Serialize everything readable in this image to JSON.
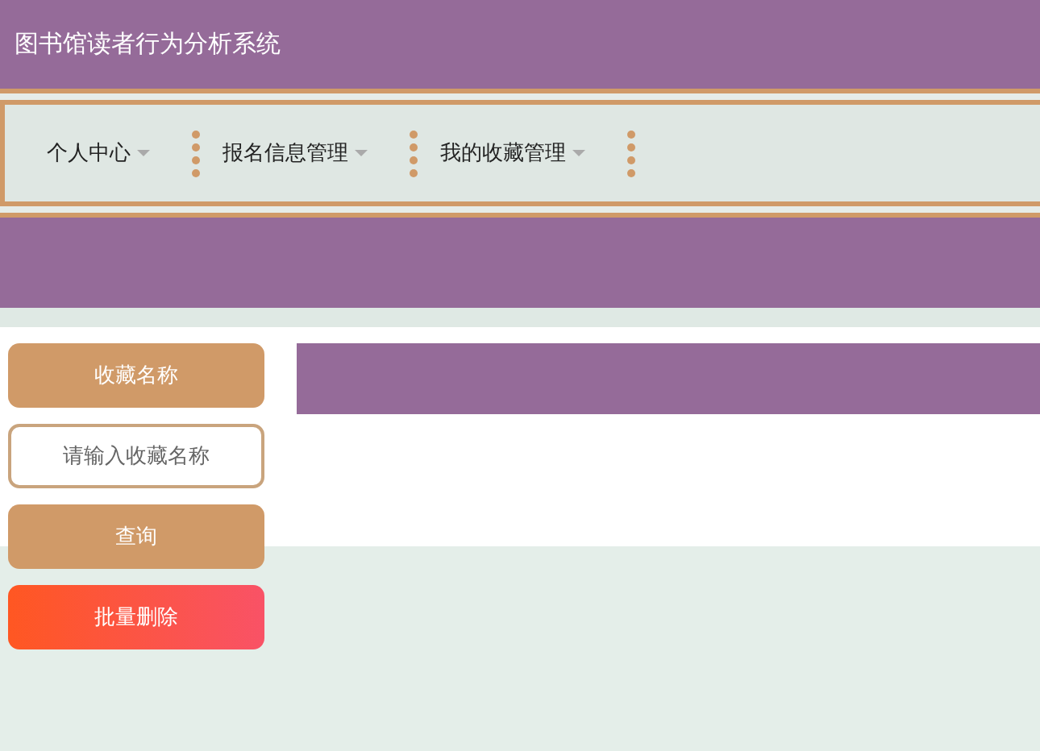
{
  "header": {
    "title": "图书馆读者行为分析系统"
  },
  "nav": {
    "items": [
      {
        "label": "个人中心"
      },
      {
        "label": "报名信息管理"
      },
      {
        "label": "我的收藏管理"
      }
    ]
  },
  "search": {
    "label": "收藏名称",
    "placeholder": "请输入收藏名称",
    "buttons": [
      {
        "label": "查询",
        "kind": "query"
      },
      {
        "label": "批量删除",
        "kind": "delete"
      }
    ]
  }
}
